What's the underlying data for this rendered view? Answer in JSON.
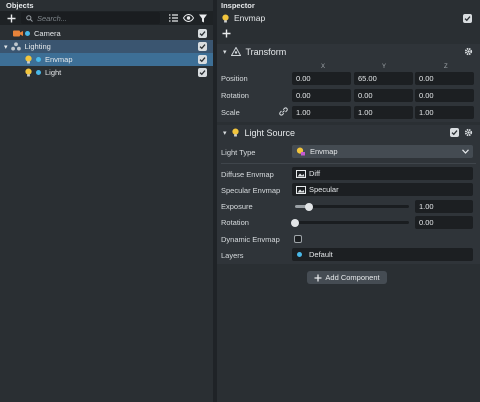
{
  "objects": {
    "title": "Objects",
    "search_placeholder": "Search...",
    "tree": [
      {
        "label": "Camera",
        "depth": 0,
        "icon": "camera-icon",
        "expanded": false,
        "checked": true,
        "selected": false
      },
      {
        "label": "Lighting",
        "depth": 0,
        "icon": "group-icon",
        "expanded": true,
        "checked": true,
        "selected": "parent"
      },
      {
        "label": "Envmap",
        "depth": 1,
        "icon": "bulb-icon",
        "checked": true,
        "selected": true
      },
      {
        "label": "Light",
        "depth": 1,
        "icon": "bulb-icon",
        "checked": true,
        "selected": false
      }
    ]
  },
  "inspector": {
    "title": "Inspector",
    "object_name": "Envmap",
    "enabled": true,
    "transform": {
      "title": "Transform",
      "axes": [
        "X",
        "Y",
        "Z"
      ],
      "position_label": "Position",
      "rotation_label": "Rotation",
      "scale_label": "Scale",
      "position": [
        "0.00",
        "65.00",
        "0.00"
      ],
      "rotation": [
        "0.00",
        "0.00",
        "0.00"
      ],
      "scale": [
        "1.00",
        "1.00",
        "1.00"
      ]
    },
    "light_source": {
      "title": "Light Source",
      "enabled": true,
      "light_type_label": "Light Type",
      "light_type_value": "Envmap",
      "diffuse_label": "Diffuse Envmap",
      "diffuse_value": "Diff",
      "specular_label": "Specular Envmap",
      "specular_value": "Specular",
      "exposure_label": "Exposure",
      "exposure_value": "1.00",
      "exposure_fraction": 0.12,
      "rotation_label": "Rotation",
      "rotation_value": "0.00",
      "rotation_fraction": 0.0,
      "dynamic_label": "Dynamic Envmap",
      "dynamic_checked": false,
      "layers_label": "Layers",
      "layers_value": "Default"
    },
    "add_component_label": "Add Component"
  },
  "colors": {
    "accent_dot": "#49b8e8",
    "selection": "#3d6f96",
    "bulb": "#f2c53d",
    "camera": "#e8833a"
  }
}
